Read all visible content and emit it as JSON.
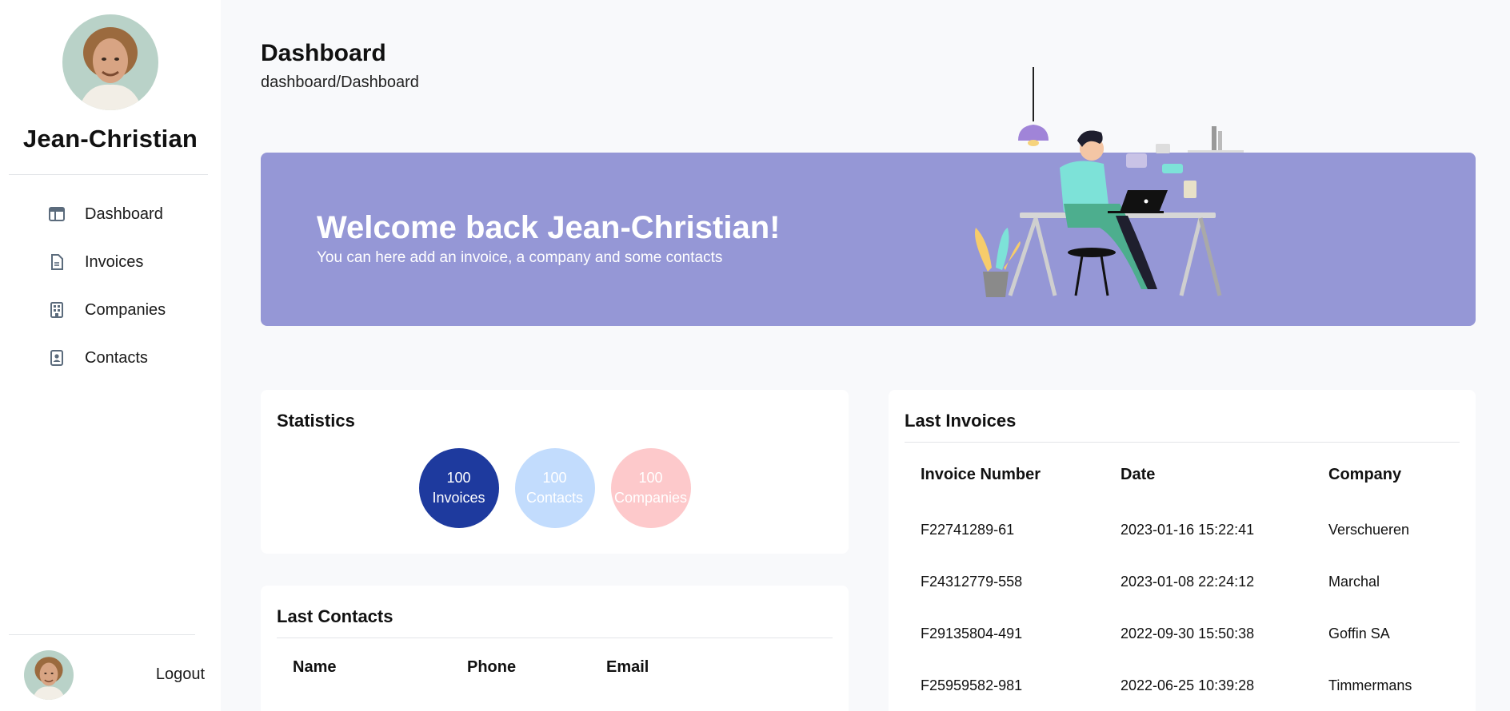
{
  "user": {
    "name": "Jean-Christian"
  },
  "sidebar": {
    "items": [
      {
        "label": "Dashboard",
        "icon": "layout-icon"
      },
      {
        "label": "Invoices",
        "icon": "document-icon"
      },
      {
        "label": "Companies",
        "icon": "building-icon"
      },
      {
        "label": "Contacts",
        "icon": "contact-card-icon"
      }
    ],
    "logout": "Logout"
  },
  "header": {
    "title": "Dashboard",
    "breadcrumb": "dashboard/Dashboard"
  },
  "banner": {
    "title": "Welcome back Jean-Christian!",
    "subtitle": "You can here add an invoice, a company and some contacts",
    "color": "#9597d6"
  },
  "statistics": {
    "title": "Statistics",
    "items": [
      {
        "count": "100",
        "label": "Invoices",
        "color": "#1e3a9e"
      },
      {
        "count": "100",
        "label": "Contacts",
        "color": "#c2dcfd"
      },
      {
        "count": "100",
        "label": "Companies",
        "color": "#fdc9cb"
      }
    ]
  },
  "last_contacts": {
    "title": "Last Contacts",
    "columns": [
      "Name",
      "Phone",
      "Email"
    ]
  },
  "last_invoices": {
    "title": "Last Invoices",
    "columns": [
      "Invoice Number",
      "Date",
      "Company"
    ],
    "rows": [
      [
        "F22741289-61",
        "2023-01-16 15:22:41",
        "Verschueren"
      ],
      [
        "F24312779-558",
        "2023-01-08 22:24:12",
        "Marchal"
      ],
      [
        "F29135804-491",
        "2022-09-30 15:50:38",
        "Goffin SA"
      ],
      [
        "F25959582-981",
        "2022-06-25 10:39:28",
        "Timmermans"
      ]
    ]
  }
}
